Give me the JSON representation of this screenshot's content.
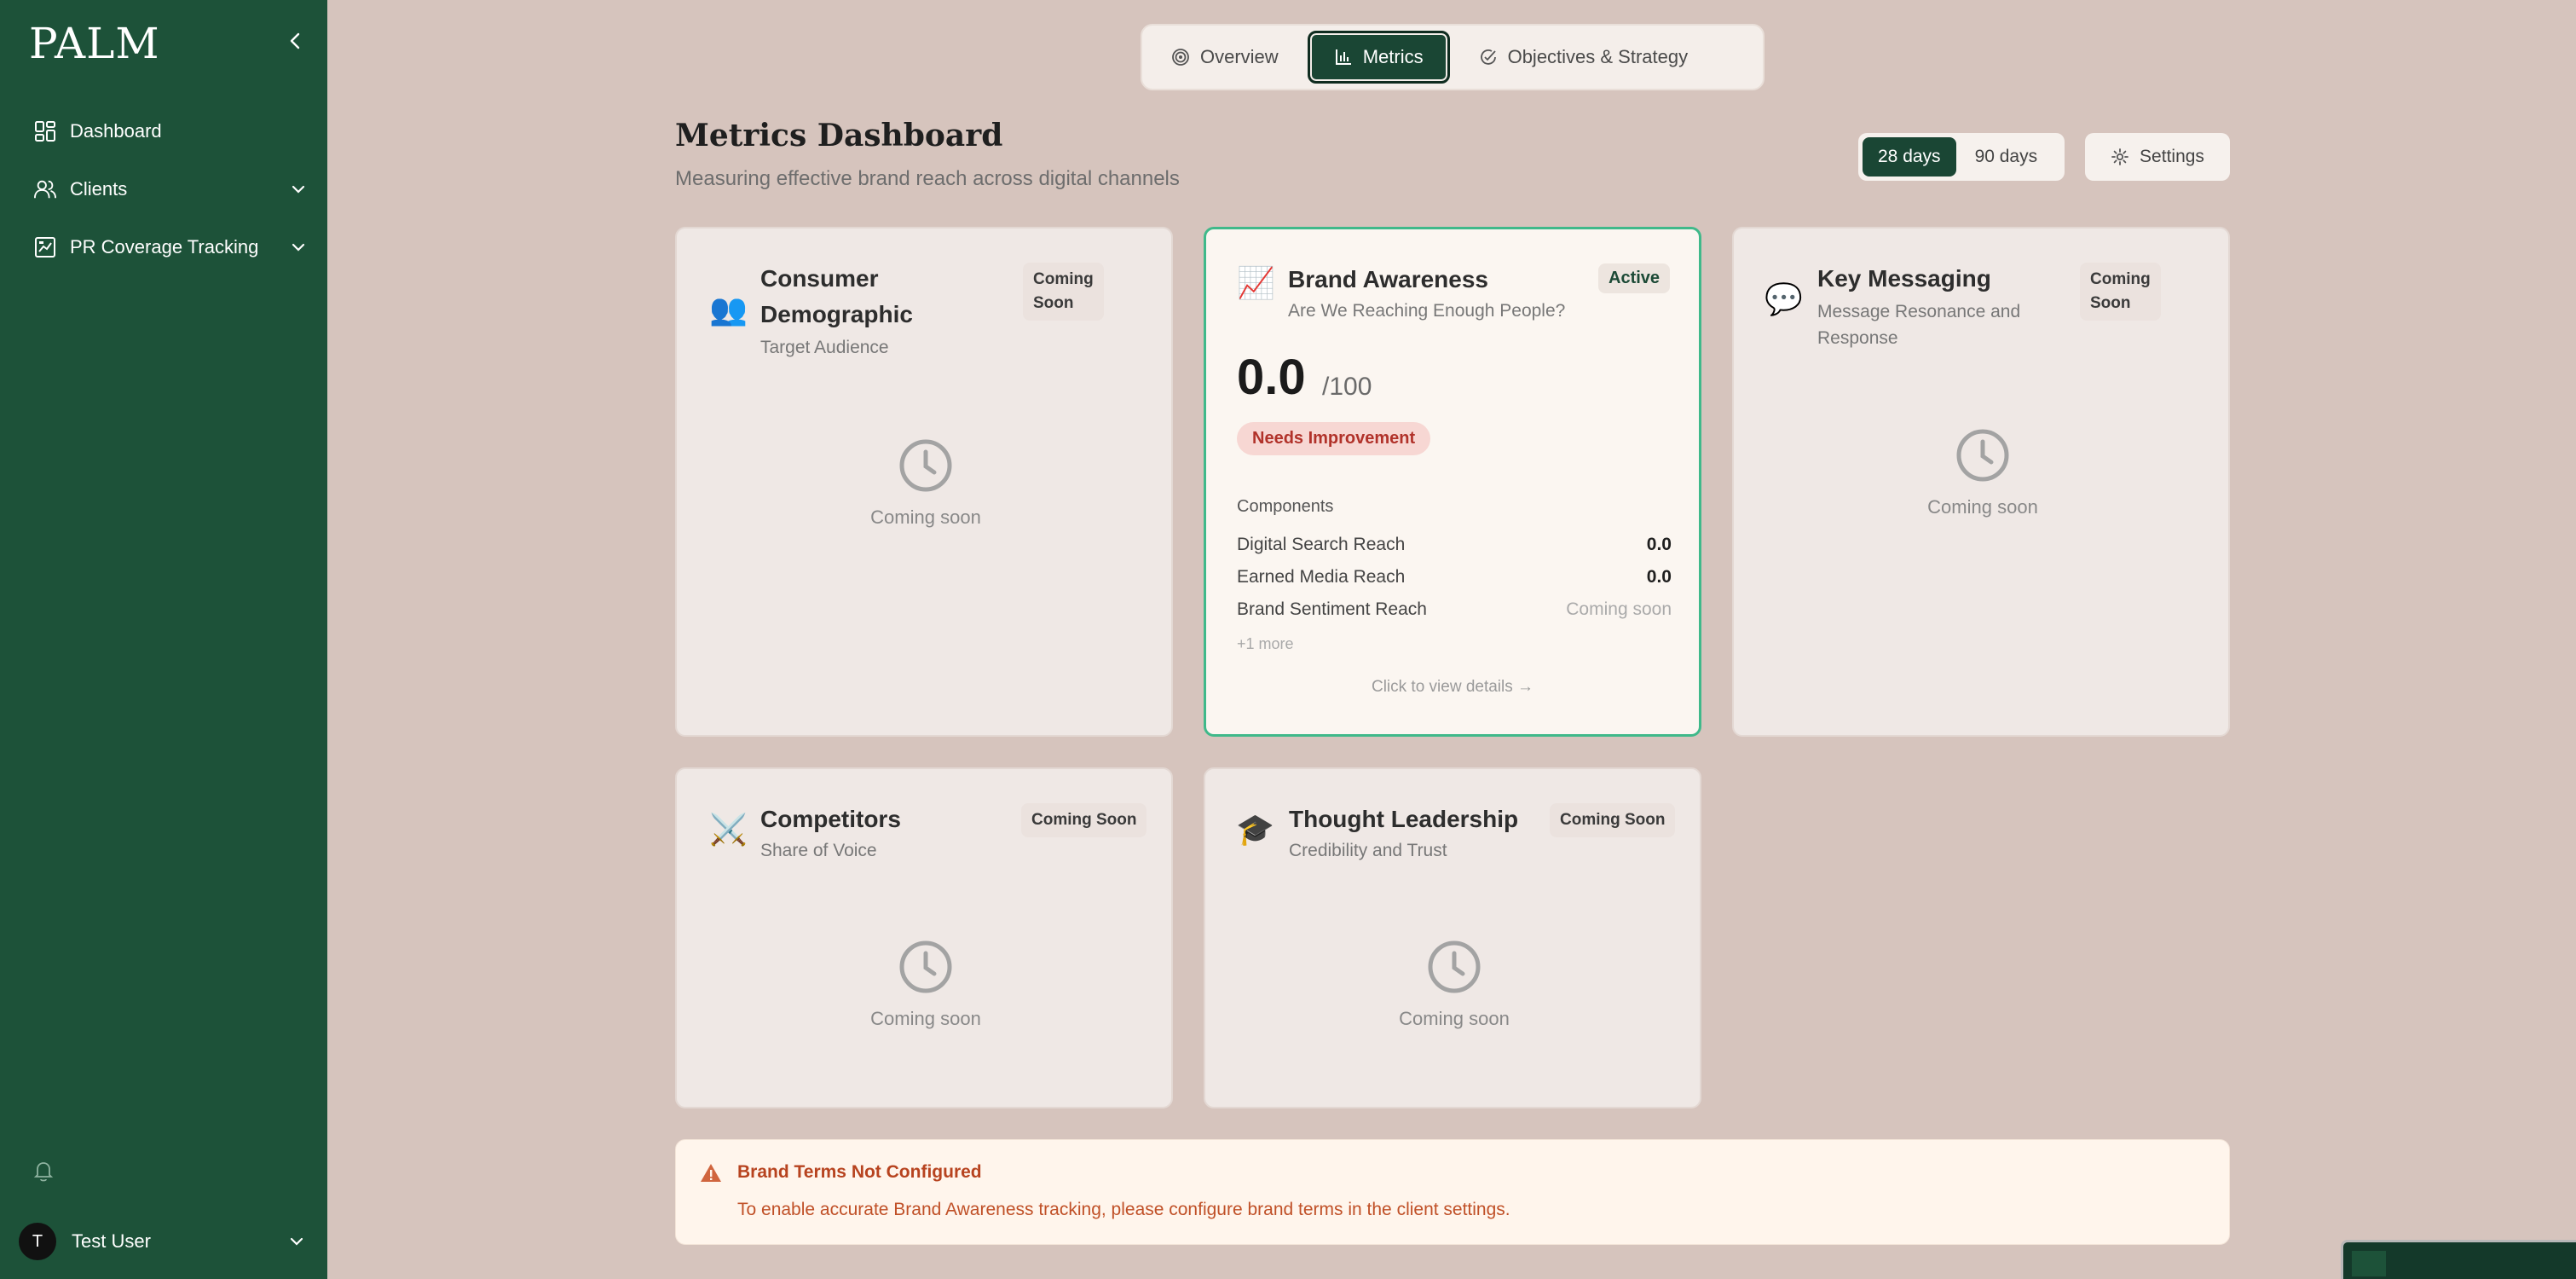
{
  "app": {
    "logo": "PALM"
  },
  "sidebar": {
    "items": [
      {
        "label": "Dashboard",
        "icon": "grid-icon"
      },
      {
        "label": "Clients",
        "icon": "users-icon"
      },
      {
        "label": "PR Coverage Tracking",
        "icon": "chart-box-icon"
      }
    ],
    "user": {
      "initial": "T",
      "name": "Test User"
    }
  },
  "tabs": [
    {
      "label": "Overview",
      "icon": "target-icon"
    },
    {
      "label": "Metrics",
      "icon": "bar-chart-icon",
      "active": true
    },
    {
      "label": "Objectives & Strategy",
      "icon": "check-circle-icon"
    }
  ],
  "header": {
    "title": "Metrics Dashboard",
    "subtitle": "Measuring effective brand reach across digital channels",
    "ranges": [
      "28 days",
      "90 days"
    ],
    "active_range": "28 days",
    "settings_label": "Settings"
  },
  "cards": {
    "consumer": {
      "icon": "👥",
      "title_line1": "Consumer",
      "title_line2": "Demographic",
      "subtitle": "Target Audience",
      "badge_line1": "Coming",
      "badge_line2": "Soon",
      "placeholder": "Coming soon"
    },
    "brand": {
      "icon": "📈",
      "title": "Brand Awareness",
      "subtitle": "Are We Reaching Enough People?",
      "badge": "Active",
      "score": "0.0",
      "score_max": "/100",
      "status": "Needs Improvement",
      "components_label": "Components",
      "components": [
        {
          "label": "Digital Search Reach",
          "value": "0.0"
        },
        {
          "label": "Earned Media Reach",
          "value": "0.0"
        },
        {
          "label": "Brand Sentiment Reach",
          "value": "Coming soon"
        }
      ],
      "more": "+1 more",
      "details": "Click to view details →"
    },
    "messaging": {
      "icon": "💬",
      "title": "Key Messaging",
      "subtitle_line1": "Message Resonance and",
      "subtitle_line2": "Response",
      "badge_line1": "Coming",
      "badge_line2": "Soon",
      "placeholder": "Coming soon"
    },
    "competitors": {
      "icon": "⚔️",
      "title": "Competitors",
      "subtitle": "Share of Voice",
      "badge": "Coming Soon",
      "placeholder": "Coming soon"
    },
    "thought": {
      "icon": "🎓",
      "title": "Thought Leadership",
      "subtitle": "Credibility and Trust",
      "badge": "Coming Soon",
      "placeholder": "Coming soon"
    }
  },
  "warning": {
    "title": "Brand Terms Not Configured",
    "text": "To enable accurate Brand Awareness tracking, please configure brand terms in the client settings."
  },
  "colors": {
    "sidebar": "#1d5239",
    "accent": "#1a4634",
    "active_border": "#3fb98a",
    "warning": "#b7431f"
  }
}
